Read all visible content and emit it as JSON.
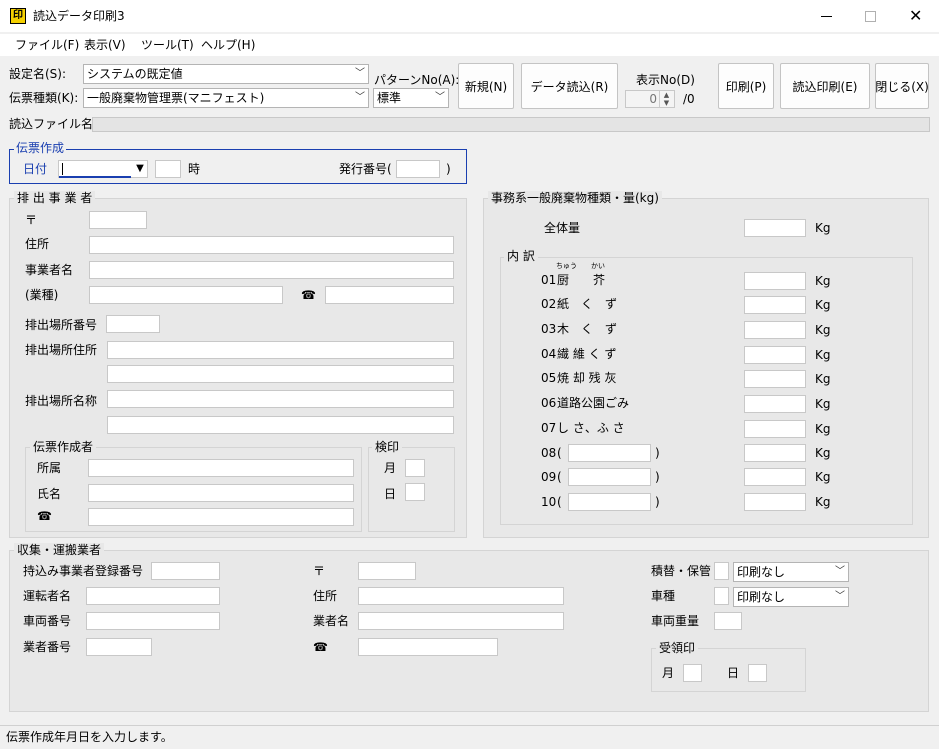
{
  "window": {
    "title": "読込データ印刷3",
    "icon_text": "印"
  },
  "menu": [
    "ファイル(F)",
    "表示(V)",
    "ツール(T)",
    "ヘルプ(H)"
  ],
  "toolbar": {
    "setting_label": "設定名(S):",
    "setting_value": "システムの既定値",
    "slip_type_label": "伝票種類(K):",
    "slip_type_value": "一般廃棄物管理票(マニフェスト)",
    "pattern_label": "パターンNo(A):",
    "pattern_value": "標準",
    "new_btn": "新規(N)",
    "load_btn": "データ読込(R)",
    "display_no_label": "表示No(D)",
    "display_no_value": "0",
    "display_no_total": "/0",
    "print_btn": "印刷(P)",
    "load_print_btn": "読込印刷(E)",
    "close_btn": "閉じる(X)"
  },
  "read_file": {
    "label": "読込ファイル名",
    "value": ""
  },
  "slip_create": {
    "title": "伝票作成",
    "date_label": "日付",
    "hour_label": "時",
    "issue_no_label": "発行番号(",
    "issue_no_close": ")"
  },
  "emitter": {
    "title": "排 出 事 業 者",
    "postal": "〒",
    "address": "住所",
    "name": "事業者名",
    "industry": "(業種)",
    "tel": "☎",
    "site_no": "排出場所番号",
    "site_address": "排出場所住所",
    "site_name": "排出場所名称",
    "creator_title": "伝票作成者",
    "dept": "所属",
    "person": "氏名",
    "creator_tel": "☎",
    "stamp_title": "検印",
    "month": "月",
    "day": "日"
  },
  "waste": {
    "title": "事務系一般廃棄物種類・量(kg)",
    "total_label": "全体量",
    "unit": "Kg",
    "breakdown": "内 訳",
    "items": [
      {
        "no": "01",
        "name": "厨　　芥",
        "ruby": "ちゅう　　かい"
      },
      {
        "no": "02",
        "name": "紙　く　ず"
      },
      {
        "no": "03",
        "name": "木　く　ず"
      },
      {
        "no": "04",
        "name": "繊 維 く ず"
      },
      {
        "no": "05",
        "name": "焼 却 残 灰"
      },
      {
        "no": "06",
        "name": "道路公園ごみ"
      },
      {
        "no": "07",
        "name": "し さ、ふ さ"
      },
      {
        "no": "08",
        "open": "(",
        "close": ")"
      },
      {
        "no": "09",
        "open": "(",
        "close": ")"
      },
      {
        "no": "10",
        "open": "(",
        "close": ")"
      }
    ]
  },
  "collector": {
    "title": "収集・運搬業者",
    "reg_no": "持込み事業者登録番号",
    "driver": "運転者名",
    "vehicle_no": "車両番号",
    "company_no": "業者番号",
    "postal": "〒",
    "address": "住所",
    "company_name": "業者名",
    "tel": "☎",
    "transship": "積替・保管",
    "transship_value": "印刷なし",
    "vehicle_type": "車種",
    "vehicle_type_value": "印刷なし",
    "vehicle_weight": "車両重量",
    "receipt_title": "受領印",
    "month": "月",
    "day": "日"
  },
  "status": "伝票作成年月日を入力します。"
}
